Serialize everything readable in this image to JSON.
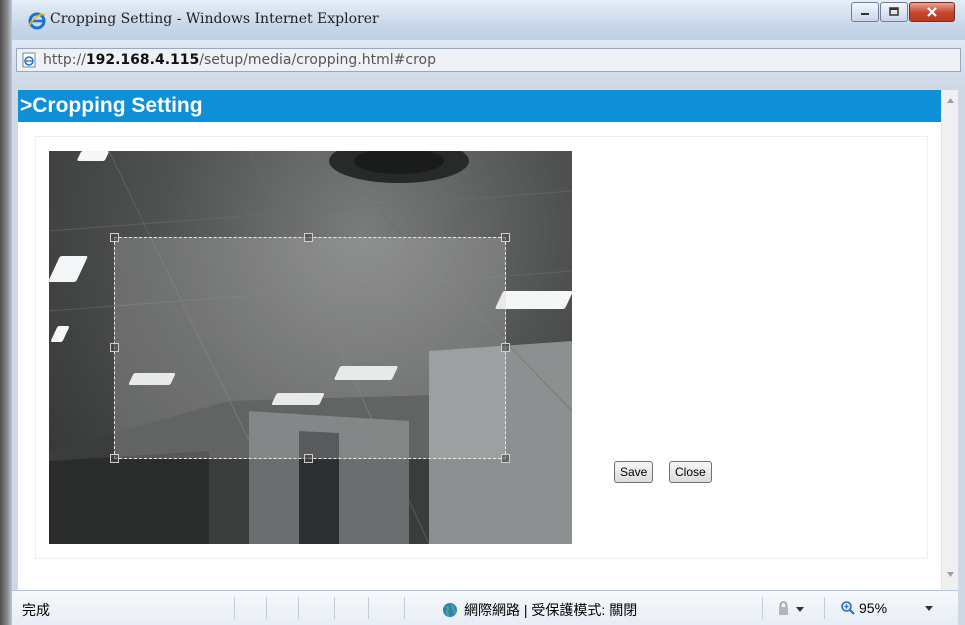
{
  "window": {
    "title": "Cropping Setting - Windows Internet Explorer",
    "url_prefix": "http://",
    "url_host": "192.168.4.115",
    "url_path": "/setup/media/cropping.html#crop"
  },
  "page": {
    "header": ">Cropping Setting",
    "save_label": "Save",
    "close_label": "Close"
  },
  "status": {
    "text": "完成",
    "zone": "網際網路 | 受保護模式: 關閉",
    "zoom": "95%"
  },
  "colors": {
    "header_bg": "#0e8fd7"
  },
  "icons": {
    "ie": "ie-logo-icon",
    "page": "page-icon",
    "globe": "globe-icon",
    "lock": "lock-icon",
    "zoom": "magnifier-icon"
  }
}
